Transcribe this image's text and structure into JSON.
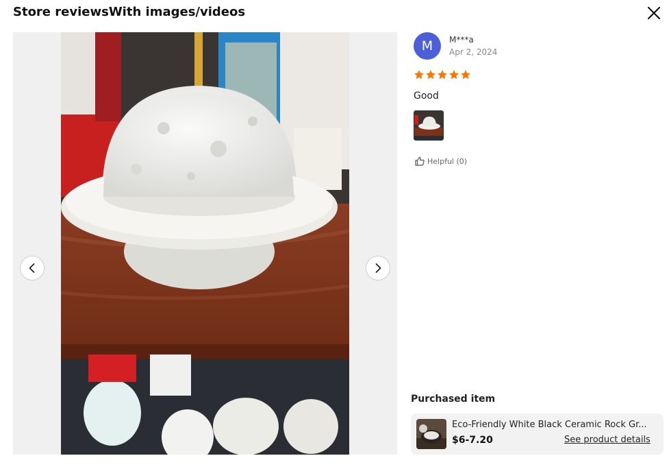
{
  "header": {
    "title": "Store reviewsWith images/videos"
  },
  "icons": {
    "close": "close-icon",
    "prev": "chevron-left-icon",
    "next": "chevron-right-icon",
    "star": "star-icon",
    "helpful": "thumbs-up-icon"
  },
  "review": {
    "avatar_initial": "M",
    "avatar_color": "#4d5fd8",
    "reviewer": "M***a",
    "date": "Apr 2, 2024",
    "rating": 5,
    "star_color": "#fb7701",
    "text": "Good",
    "helpful_label": "Helpful (0)"
  },
  "purchased": {
    "label": "Purchased item",
    "product_name": "Eco-Friendly White Black Ceramic Rock Gr...",
    "price": "$6-7.20",
    "details_link": "See product details"
  }
}
